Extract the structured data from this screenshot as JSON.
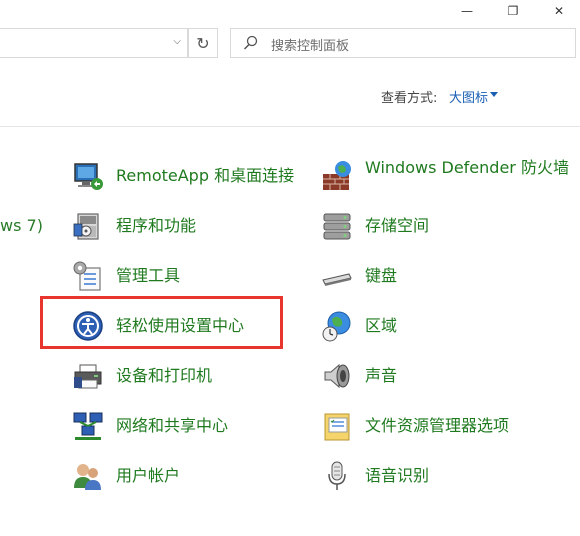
{
  "window": {
    "minimize": "—",
    "maximize": "❐",
    "close": "✕"
  },
  "address": {
    "dropdown": "⌵",
    "refresh": "↻"
  },
  "search": {
    "placeholder": "搜索控制面板"
  },
  "view": {
    "label": "查看方式:",
    "value": "大图标"
  },
  "left_cut_text": "ws 7)",
  "items_left": [
    {
      "label": "RemoteApp 和桌面连接",
      "icon": "remoteapp-icon"
    },
    {
      "label": "程序和功能",
      "icon": "programs-icon"
    },
    {
      "label": "管理工具",
      "icon": "admin-tools-icon"
    },
    {
      "label": "轻松使用设置中心",
      "icon": "ease-of-access-icon"
    },
    {
      "label": "设备和打印机",
      "icon": "printer-icon"
    },
    {
      "label": "网络和共享中心",
      "icon": "network-icon"
    },
    {
      "label": "用户帐户",
      "icon": "users-icon"
    }
  ],
  "items_right": [
    {
      "label": "Windows Defender 防火墙",
      "icon": "firewall-icon"
    },
    {
      "label": "存储空间",
      "icon": "storage-icon"
    },
    {
      "label": "键盘",
      "icon": "keyboard-icon"
    },
    {
      "label": "区域",
      "icon": "region-icon"
    },
    {
      "label": "声音",
      "icon": "sound-icon"
    },
    {
      "label": "文件资源管理器选项",
      "icon": "folder-options-icon"
    },
    {
      "label": "语音识别",
      "icon": "microphone-icon"
    }
  ],
  "colors": {
    "link": "#1f7a1f",
    "accent": "#1a5fb4",
    "highlight": "#e8352e"
  }
}
